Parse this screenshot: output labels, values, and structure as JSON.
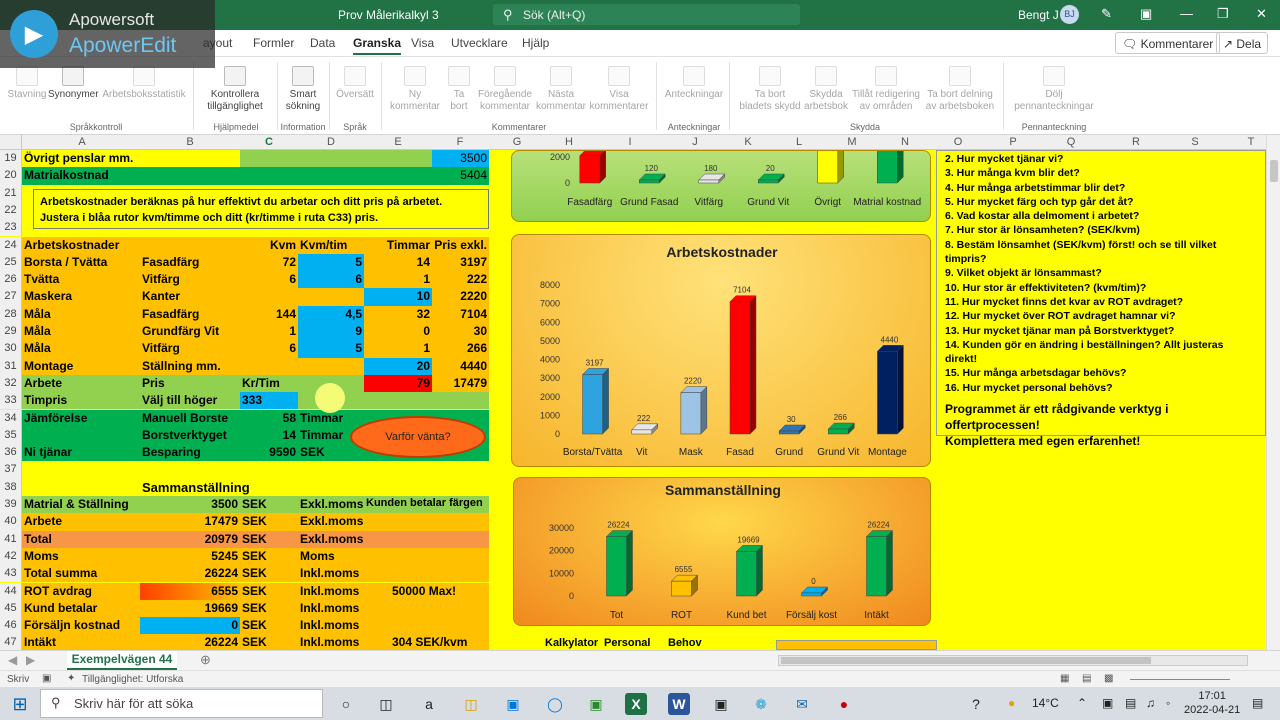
{
  "window": {
    "file_title": "Prov Målerikalkyl 3",
    "search_placeholder": "Sök (Alt+Q)",
    "user": "Bengt J",
    "user_initials": "BJ"
  },
  "watermark": {
    "line1": "Apowersoft",
    "line2": "ApowerEdit"
  },
  "ribbon_tabs": {
    "items": [
      "ayout",
      "Formler",
      "Data",
      "Granska",
      "Visa",
      "Utvecklare",
      "Hjälp"
    ],
    "active": "Granska",
    "comments_button": "Kommentarer",
    "share_button": "Dela"
  },
  "ribbon": {
    "buttons": [
      {
        "label": "Stavning",
        "enabled": false
      },
      {
        "label": "Synonymer",
        "enabled": true
      },
      {
        "label": "Arbetsboksstatistik",
        "enabled": false
      },
      {
        "label": "Kontrollera tillgänglighet",
        "enabled": true
      },
      {
        "label": "Smart sökning",
        "enabled": true
      },
      {
        "label": "Översätt",
        "enabled": false
      },
      {
        "label": "Ny kommentar",
        "enabled": false
      },
      {
        "label": "Ta bort",
        "enabled": false
      },
      {
        "label": "Föregående kommentar",
        "enabled": false
      },
      {
        "label": "Nästa kommentar",
        "enabled": false
      },
      {
        "label": "Visa kommentarer",
        "enabled": false
      },
      {
        "label": "Anteckningar",
        "enabled": false
      },
      {
        "label": "Ta bort bladets skydd",
        "enabled": false
      },
      {
        "label": "Skydda arbetsbok",
        "enabled": false
      },
      {
        "label": "Tillåt redigering av områden",
        "enabled": false
      },
      {
        "label": "Ta bort delning av arbetsboken",
        "enabled": false
      },
      {
        "label": "Dölj pennanteckningar",
        "enabled": false
      }
    ],
    "groups": [
      "Språkkontroll",
      "Hjälpmedel",
      "Information",
      "Språk",
      "Kommentarer",
      "Anteckningar",
      "Skydda",
      "Pennanteckning"
    ]
  },
  "columns": [
    "A",
    "B",
    "C",
    "D",
    "E",
    "F",
    "G",
    "H",
    "I",
    "J",
    "K",
    "L",
    "M",
    "N",
    "O",
    "P",
    "Q",
    "R",
    "S",
    "T"
  ],
  "rows": [
    {
      "n": "19",
      "a": "Övrigt penslar mm.",
      "b": "",
      "c": "",
      "d": "",
      "e": "",
      "f": "3500"
    },
    {
      "n": "20",
      "a": "Matrialkostnad",
      "b": "",
      "c": "",
      "d": "",
      "e": "",
      "f": "5404"
    },
    {
      "n": "21",
      "a": "",
      "b": "",
      "c": "",
      "d": "",
      "e": "",
      "f": ""
    },
    {
      "n": "22",
      "a": "",
      "b": "",
      "c": "",
      "d": "",
      "e": "",
      "f": ""
    },
    {
      "n": "23",
      "a": "",
      "b": "",
      "c": "",
      "d": "",
      "e": "",
      "f": ""
    },
    {
      "n": "24",
      "a": "Arbetskostnader",
      "b": "",
      "c": "Kvm",
      "d": "Kvm/tim",
      "e": "Timmar",
      "f": "Pris exkl."
    },
    {
      "n": "25",
      "a": "Borsta / Tvätta",
      "b": "Fasadfärg",
      "c": "72",
      "d": "5",
      "e": "14",
      "f": "3197"
    },
    {
      "n": "26",
      "a": "Tvätta",
      "b": "Vitfärg",
      "c": "6",
      "d": "6",
      "e": "1",
      "f": "222"
    },
    {
      "n": "27",
      "a": "Maskera",
      "b": "Kanter",
      "c": "",
      "d": "",
      "e": "10",
      "f": "2220"
    },
    {
      "n": "28",
      "a": "Måla",
      "b": "Fasadfärg",
      "c": "144",
      "d": "4,5",
      "e": "32",
      "f": "7104"
    },
    {
      "n": "29",
      "a": "Måla",
      "b": "Grundfärg Vit",
      "c": "1",
      "d": "9",
      "e": "0",
      "f": "30"
    },
    {
      "n": "30",
      "a": "Måla",
      "b": "Vitfärg",
      "c": "6",
      "d": "5",
      "e": "1",
      "f": "266"
    },
    {
      "n": "31",
      "a": "Montage",
      "b": "Ställning mm.",
      "c": "",
      "d": "",
      "e": "20",
      "f": "4440"
    },
    {
      "n": "32",
      "a": "Arbete",
      "b": "Pris",
      "c": "Kr/Tim",
      "d": "",
      "e": "79",
      "f": "17479"
    },
    {
      "n": "33",
      "a": "Timpris",
      "b": "Välj till höger",
      "c": "333",
      "d": "",
      "e": "",
      "f": ""
    },
    {
      "n": "34",
      "a": "Jämförelse",
      "b": "Manuell Borste",
      "c": "58",
      "d": "Timmar",
      "e": "",
      "f": ""
    },
    {
      "n": "35",
      "a": "",
      "b": "Borstverktyget",
      "c": "14",
      "d": "Timmar",
      "e": "",
      "f": ""
    },
    {
      "n": "36",
      "a": "Ni tjänar",
      "b": "Besparing",
      "c": "9590",
      "d": "SEK",
      "e": "",
      "f": ""
    },
    {
      "n": "37",
      "a": "",
      "b": "",
      "c": "",
      "d": "",
      "e": "",
      "f": ""
    },
    {
      "n": "38",
      "a": "",
      "b": "Sammanställning",
      "c": "",
      "d": "",
      "e": "",
      "f": ""
    },
    {
      "n": "39",
      "a": "Matrial & Ställning",
      "b": "",
      "c": "3500",
      "d": "SEK",
      "e": "Exkl.moms",
      "f": "Kunden betalar färgen"
    },
    {
      "n": "40",
      "a": "Arbete",
      "b": "",
      "c": "17479",
      "d": "SEK",
      "e": "Exkl.moms",
      "f": ""
    },
    {
      "n": "41",
      "a": "Total",
      "b": "",
      "c": "20979",
      "d": "SEK",
      "e": "Exkl.moms",
      "f": ""
    },
    {
      "n": "42",
      "a": "Moms",
      "b": "",
      "c": "5245",
      "d": "SEK",
      "e": "Moms",
      "f": ""
    },
    {
      "n": "43",
      "a": "Total summa",
      "b": "",
      "c": "26224",
      "d": "SEK",
      "e": "Inkl.moms",
      "f": ""
    },
    {
      "n": "44",
      "a": "ROT avdrag",
      "b": "",
      "c": "6555",
      "d": "SEK",
      "e": "Inkl.moms",
      "f": "50000 Max!"
    },
    {
      "n": "45",
      "a": "Kund betalar",
      "b": "",
      "c": "19669",
      "d": "SEK",
      "e": "Inkl.moms",
      "f": ""
    },
    {
      "n": "46",
      "a": "Försäljn kostnad",
      "b": "",
      "c": "0",
      "d": "SEK",
      "e": "Inkl.moms",
      "f": ""
    },
    {
      "n": "47",
      "a": "Intäkt",
      "b": "",
      "c": "26224",
      "d": "SEK",
      "e": "Inkl.moms",
      "f": "304 SEK/kvm"
    }
  ],
  "note": {
    "line1": "Arbetskostnader beräknas på hur effektivt du arbetar och ditt pris på arbetet.",
    "line2": "Justera i blåa rutor kvm/timme och ditt (kr/timme i ruta C33) pris."
  },
  "cloud": {
    "label": "Varför vänta?"
  },
  "questions": {
    "items": [
      "2. Hur mycket tjänar vi?",
      "3. Hur många kvm blir det?",
      "4. Hur många arbetstimmar blir det?",
      "5. Hur mycket färg och typ går det åt?",
      "6. Vad kostar alla delmoment i arbetet?",
      "7. Hur stor är lönsamheten? (SEK/kvm)",
      "8. Bestäm lönsamhet (SEK/kvm) först! och se till vilket timpris?",
      "9. Vilket objekt är lönsammast?",
      "10. Hur stor är effektiviteten? (kvm/tim)?",
      "11. Hur mycket finns det kvar av ROT avdraget?",
      "12. Hur mycket över ROT avdraget hamnar vi?",
      "13. Hur mycket tjänar man på Borstverktyget?",
      "14. Kunden gör en ändring i beställningen? Allt justeras direkt!",
      "15. Hur många arbetsdagar behövs?",
      "16. Hur mycket personal behövs?"
    ],
    "advice1": "Programmet är ett rådgivande verktyg i offertprocessen!",
    "advice2": "Komplettera med egen erfarenhet!"
  },
  "bottom_labels": [
    "Kalkylator",
    "Personal",
    "Behov"
  ],
  "sheet_tab": "Exempelvägen 44",
  "status": {
    "ready": "Skriv",
    "accessibility": "Tillgänglighet: Utforska"
  },
  "taskbar": {
    "search_placeholder": "Skriv här för att söka",
    "temperature": "14°C",
    "time": "17:01",
    "date": "2022-04-21"
  },
  "colors": {
    "excel_green": "#217346",
    "sheet_yellow": "#ffff00",
    "row_green": "#00b050",
    "row_orange": "#ffc000",
    "row_light_green": "#92d050",
    "input_blue": "#00b0f0",
    "alert_red": "#ff0000"
  },
  "chart_data": [
    {
      "type": "bar",
      "title": "",
      "categories": [
        "Fasadfärg",
        "Grund Fasad",
        "Vitfärg",
        "Grund Vit",
        "Övrigt",
        "Matrial kostnad"
      ],
      "values": [
        2100,
        120,
        180,
        20,
        3500,
        5404
      ],
      "value_labels": [
        "",
        "120",
        "180",
        "20",
        "",
        ""
      ],
      "yticks": [
        "0",
        "2000"
      ],
      "ylim": [
        0,
        6000
      ],
      "visible_range": [
        0,
        2600
      ],
      "colors": [
        "#ff0000",
        "#00b050",
        "#e7e6e6",
        "#00b050",
        "#ffff00",
        "#00b050"
      ]
    },
    {
      "type": "bar",
      "title": "Arbetskostnader",
      "categories": [
        "Borsta/Tvätta",
        "Vit",
        "Mask",
        "Fasad",
        "Grund",
        "Grund Vit",
        "Montage"
      ],
      "values": [
        3197,
        222,
        2220,
        7104,
        30,
        266,
        4440
      ],
      "value_labels": [
        "3197",
        "222",
        "2220",
        "7104",
        "30",
        "266",
        "4440"
      ],
      "yticks": [
        "0",
        "1000",
        "2000",
        "3000",
        "4000",
        "5000",
        "6000",
        "7000",
        "8000"
      ],
      "ylim": [
        0,
        8000
      ],
      "colors": [
        "#2fa3e0",
        "#e7e6e6",
        "#9dc3e6",
        "#ff0000",
        "#2e75b6",
        "#00b050",
        "#002060"
      ]
    },
    {
      "type": "bar",
      "title": "Sammanställning",
      "categories": [
        "Tot",
        "ROT",
        "Kund bet",
        "Försälj kost",
        "Intäkt"
      ],
      "values": [
        26224,
        6555,
        19669,
        0,
        26224
      ],
      "value_labels": [
        "26224",
        "6555",
        "19669",
        "0",
        "26224"
      ],
      "yticks": [
        "0",
        "10000",
        "20000",
        "30000"
      ],
      "ylim": [
        0,
        30000
      ],
      "colors": [
        "#00b050",
        "#ffc000",
        "#00b050",
        "#00b0f0",
        "#00b050"
      ]
    }
  ]
}
